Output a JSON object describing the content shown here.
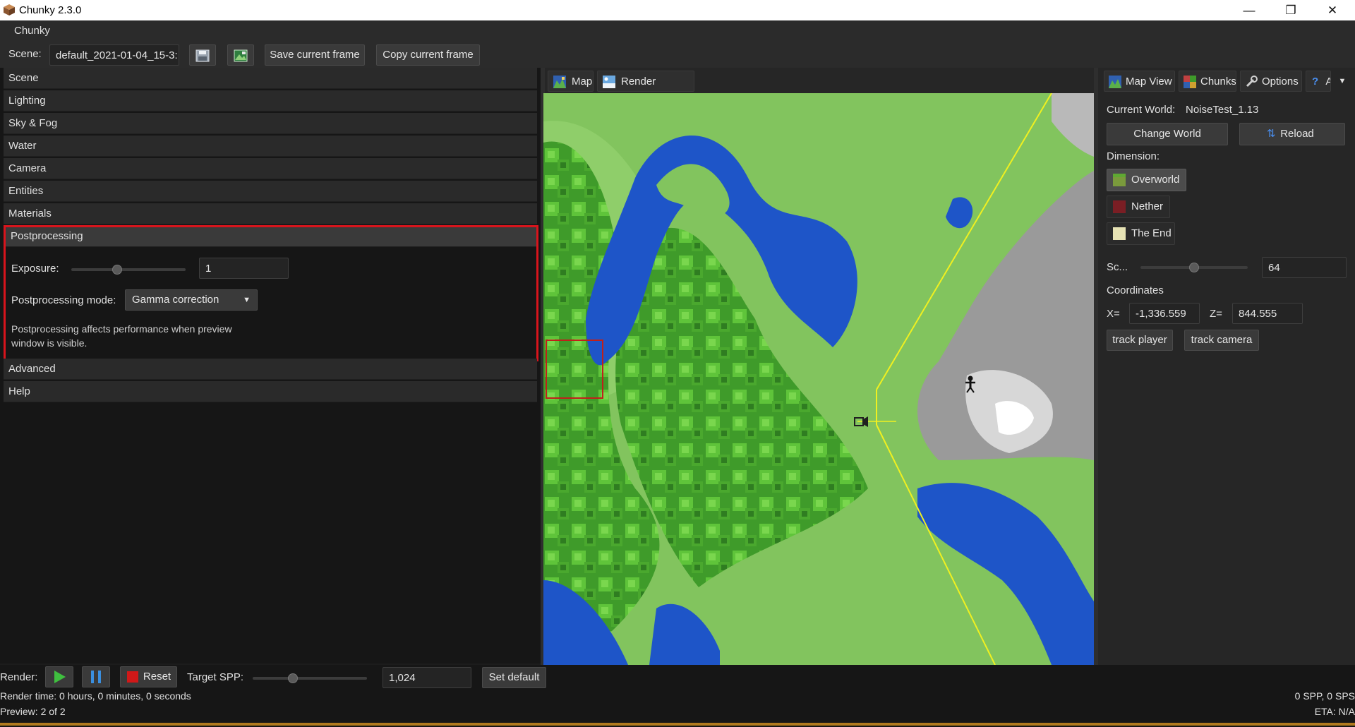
{
  "window": {
    "title": "Chunky 2.3.0",
    "minimize": "—",
    "maximize": "❐",
    "close": "✕"
  },
  "menu": {
    "chunky": "Chunky"
  },
  "scene_bar": {
    "scene_label": "Scene:",
    "scene_name": "default_2021-01-04_15-3:",
    "save_frame": "Save current frame",
    "copy_frame": "Copy current frame"
  },
  "sections": {
    "scene": "Scene",
    "lighting": "Lighting",
    "sky_fog": "Sky & Fog",
    "water": "Water",
    "camera": "Camera",
    "entities": "Entities",
    "materials": "Materials",
    "postprocessing": "Postprocessing",
    "advanced": "Advanced",
    "help": "Help"
  },
  "postprocessing": {
    "exposure_label": "Exposure:",
    "exposure_value": "1",
    "exposure_slider_fraction": 0.4,
    "mode_label": "Postprocessing mode:",
    "mode_value": "Gamma correction",
    "note": "Postprocessing affects performance when preview window is visible."
  },
  "center_tabs": {
    "map": "Map",
    "render_preview": "Render Preview"
  },
  "right_tabs": {
    "map_view": "Map View",
    "chunks": "Chunks",
    "options": "Options",
    "help": "?",
    "help_cut": "A"
  },
  "world": {
    "current_world_label": "Current World:",
    "current_world": "NoiseTest_1.13",
    "change_world": "Change World",
    "reload": "Reload",
    "dimension_label": "Dimension:",
    "overworld": "Overworld",
    "nether": "Nether",
    "the_end": "The End",
    "scale_label": "Sc...",
    "scale_value": "64",
    "scale_slider_fraction": 0.5,
    "coordinates_label": "Coordinates",
    "x_label": "X=",
    "x_value": "-1,336.559",
    "z_label": "Z=",
    "z_value": "844.555",
    "track_player": "track player",
    "track_camera": "track camera"
  },
  "render": {
    "render_label": "Render:",
    "reset": "Reset",
    "target_spp_label": "Target SPP:",
    "target_spp_value": "1,024",
    "target_spp_slider_fraction": 0.35,
    "set_default": "Set default",
    "render_time": "Render time: 0 hours, 0 minutes, 0 seconds",
    "preview": "Preview: 2 of 2",
    "spp_status": "0 SPP, 0 SPS",
    "eta": "ETA: N/A"
  },
  "colors": {
    "highlight": "#d8141c",
    "play": "#3fbf3f",
    "pause": "#3a8fe0",
    "reset": "#d01818",
    "progress": "#b07a1e"
  }
}
